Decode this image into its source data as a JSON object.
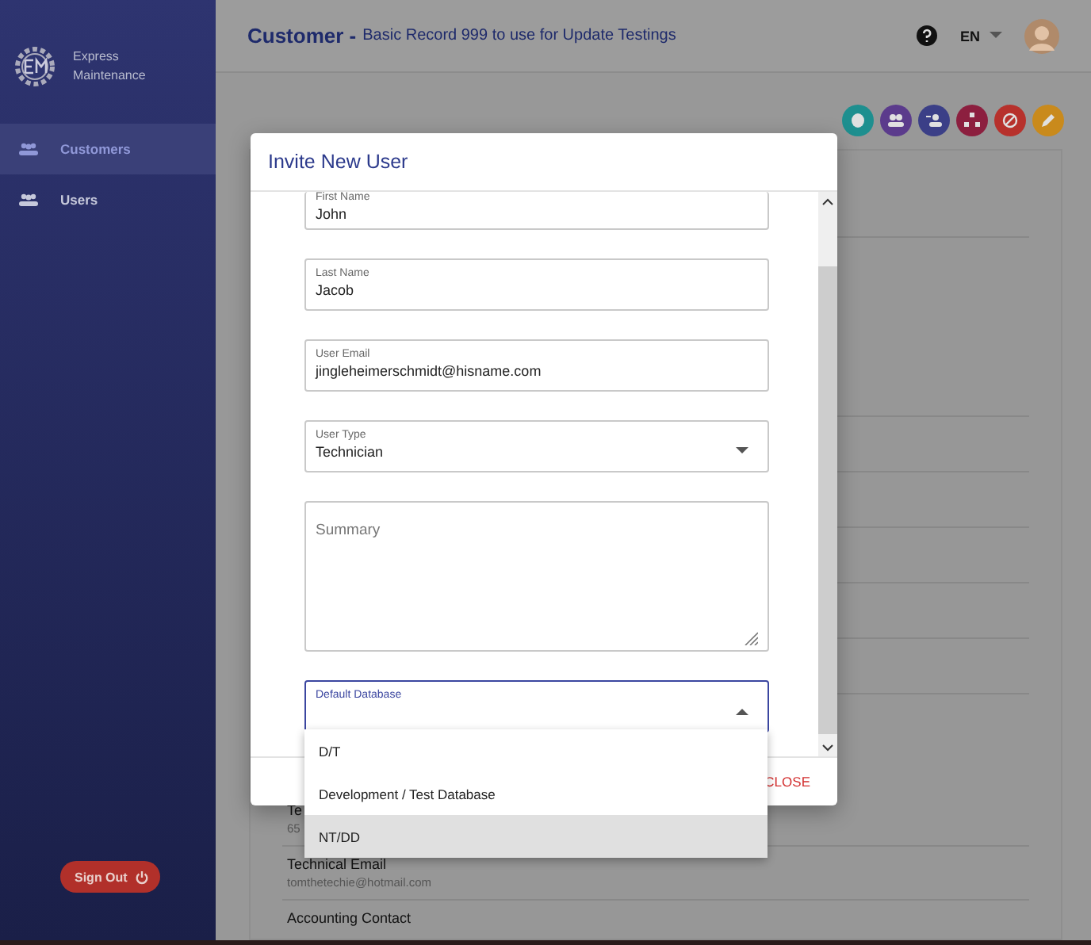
{
  "sidebar": {
    "brand": "Express Maintenance",
    "items": [
      {
        "label": "Customers",
        "selected": true
      },
      {
        "label": "Users",
        "selected": false
      }
    ],
    "sign_out": "Sign Out"
  },
  "header": {
    "title": "Customer -",
    "subtitle": "Basic Record 999 to use for Update Testings",
    "language": "EN"
  },
  "actions": [
    {
      "color": "#1e8f8f"
    },
    {
      "color": "#5b3b8c"
    },
    {
      "color": "#3b3f87"
    },
    {
      "color": "#8c1f3f"
    },
    {
      "color": "#b7312c"
    },
    {
      "color": "#c98a1c"
    }
  ],
  "background_rows": [
    {
      "label": "Te",
      "value": "65"
    },
    {
      "label": "Technical Email",
      "value": "tomthetechie@hotmail.com"
    },
    {
      "label": "Accounting Contact"
    }
  ],
  "dialog": {
    "title": "Invite New User",
    "fields": [
      {
        "kind": "text",
        "label": "First Name",
        "value": "John",
        "focused": false
      },
      {
        "kind": "text",
        "label": "Last Name",
        "value": "Jacob",
        "focused": false
      },
      {
        "kind": "text",
        "label": "User Email",
        "value": "jingleheimerschmidt@hisname.com",
        "focused": false
      },
      {
        "kind": "select",
        "label": "User Type",
        "value": "Technician",
        "expanded": false,
        "focused": false
      },
      {
        "kind": "textarea",
        "placeholder": "Summary",
        "focused": false
      },
      {
        "kind": "select",
        "label": "Default Database",
        "expanded": true,
        "focused": true
      }
    ],
    "close": "CLOSE",
    "menu": [
      {
        "label": "D/T",
        "selected": false
      },
      {
        "label": "Development / Test Database",
        "selected": false
      },
      {
        "label": "NT/DD",
        "selected": true
      }
    ]
  }
}
